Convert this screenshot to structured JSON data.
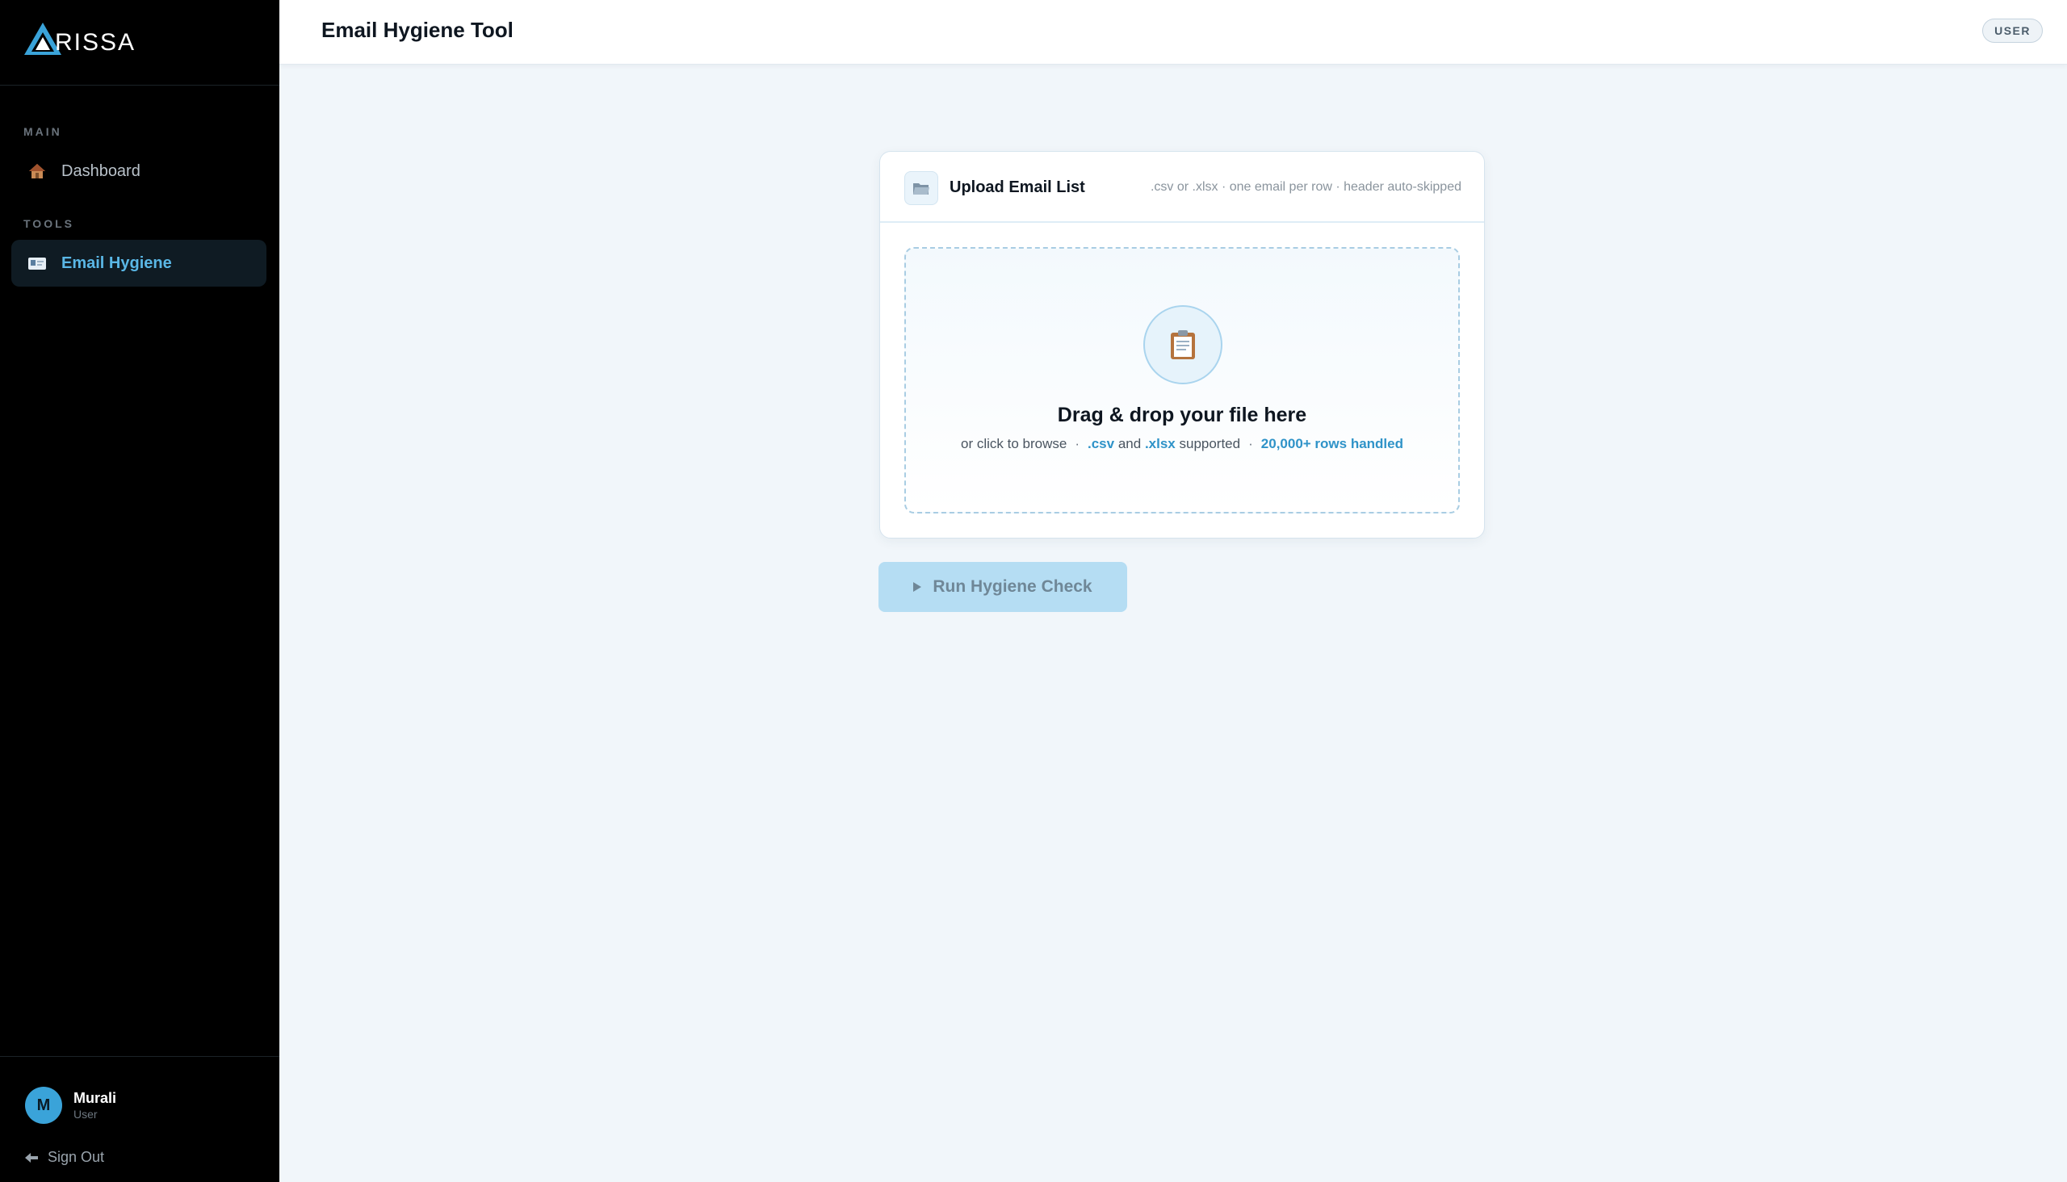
{
  "brand": {
    "logo_text": "RISSA",
    "accent": "#5ab7e6"
  },
  "sidebar": {
    "sections": [
      {
        "label": "MAIN"
      },
      {
        "label": "TOOLS"
      }
    ],
    "items": [
      {
        "label": "Dashboard",
        "icon": "house-icon"
      },
      {
        "label": "Email Hygiene",
        "icon": "id-card-icon",
        "active": true
      }
    ],
    "user": {
      "initial": "M",
      "name": "Murali",
      "role": "User"
    },
    "sign_out": "Sign Out"
  },
  "header": {
    "title": "Email Hygiene Tool",
    "role_badge": "USER"
  },
  "upload": {
    "title": "Upload Email List",
    "hint": ".csv or .xlsx · one email per row · header auto-skipped",
    "dropzone": {
      "title": "Drag & drop your file here",
      "browse": "or click to browse",
      "sep": "·",
      "ext_csv": ".csv",
      "and": "and",
      "ext_xlsx": ".xlsx",
      "supported": "supported",
      "rows": "20,000+ rows handled"
    }
  },
  "run_button": {
    "label": "Run Hygiene Check",
    "disabled": true
  }
}
